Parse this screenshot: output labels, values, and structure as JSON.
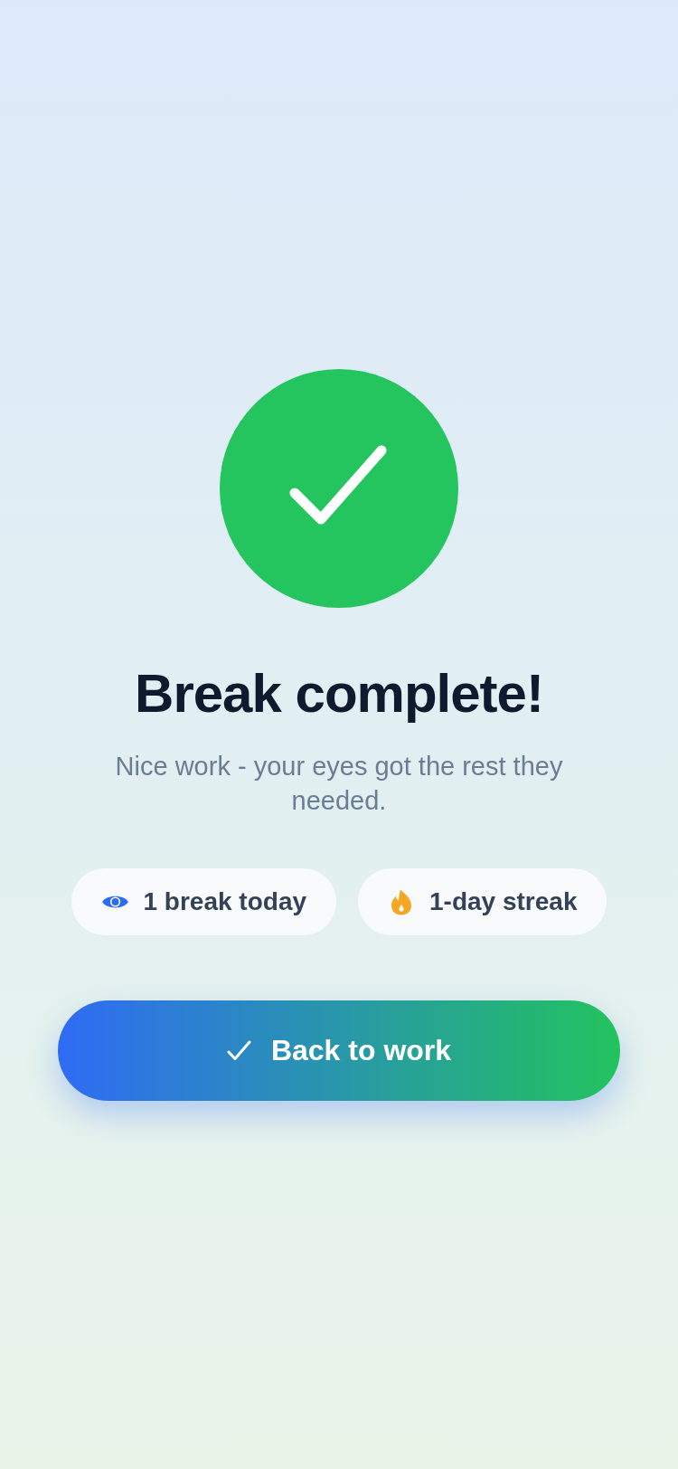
{
  "title": "Break complete!",
  "subtitle": "Nice work - your eyes got the rest they needed.",
  "stats": [
    {
      "kind": "breaks",
      "label": "1 break today"
    },
    {
      "kind": "streak",
      "label": "1-day streak"
    }
  ],
  "primary_button": {
    "label": "Back to work"
  }
}
